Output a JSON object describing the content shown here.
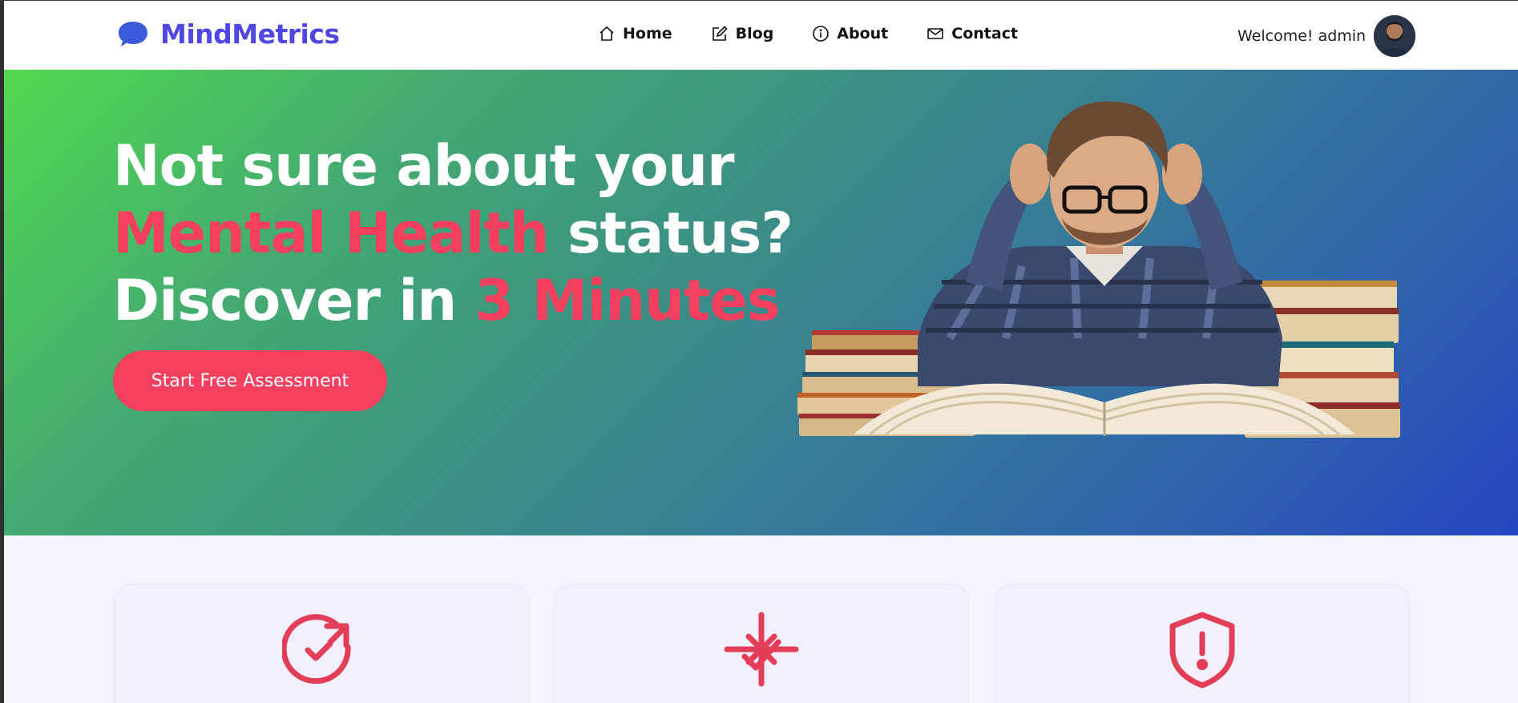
{
  "brand": {
    "name": "MindMetrics",
    "icon": "brain-chat-icon",
    "color": "#4f46e5"
  },
  "nav": {
    "items": [
      {
        "label": "Home",
        "icon": "house-icon"
      },
      {
        "label": "Blog",
        "icon": "pencil-square-icon"
      },
      {
        "label": "About",
        "icon": "info-circle-icon"
      },
      {
        "label": "Contact",
        "icon": "envelope-icon"
      }
    ]
  },
  "user": {
    "welcome": "Welcome! admin",
    "avatar": "user-avatar"
  },
  "hero": {
    "line1": "Not sure about your",
    "line2_accent": "Mental Health",
    "line2_rest": " status?",
    "line3_prefix": "Discover in ",
    "line3_accent": "3 Minutes",
    "cta_label": "Start Free Assessment",
    "accent_color": "#f43f5e",
    "illustration": "stressed-student-with-books"
  },
  "features": {
    "cards": [
      {
        "icon": "circle-check-arrow-icon"
      },
      {
        "icon": "sparkle-check-icon"
      },
      {
        "icon": "shield-alert-icon"
      }
    ]
  }
}
